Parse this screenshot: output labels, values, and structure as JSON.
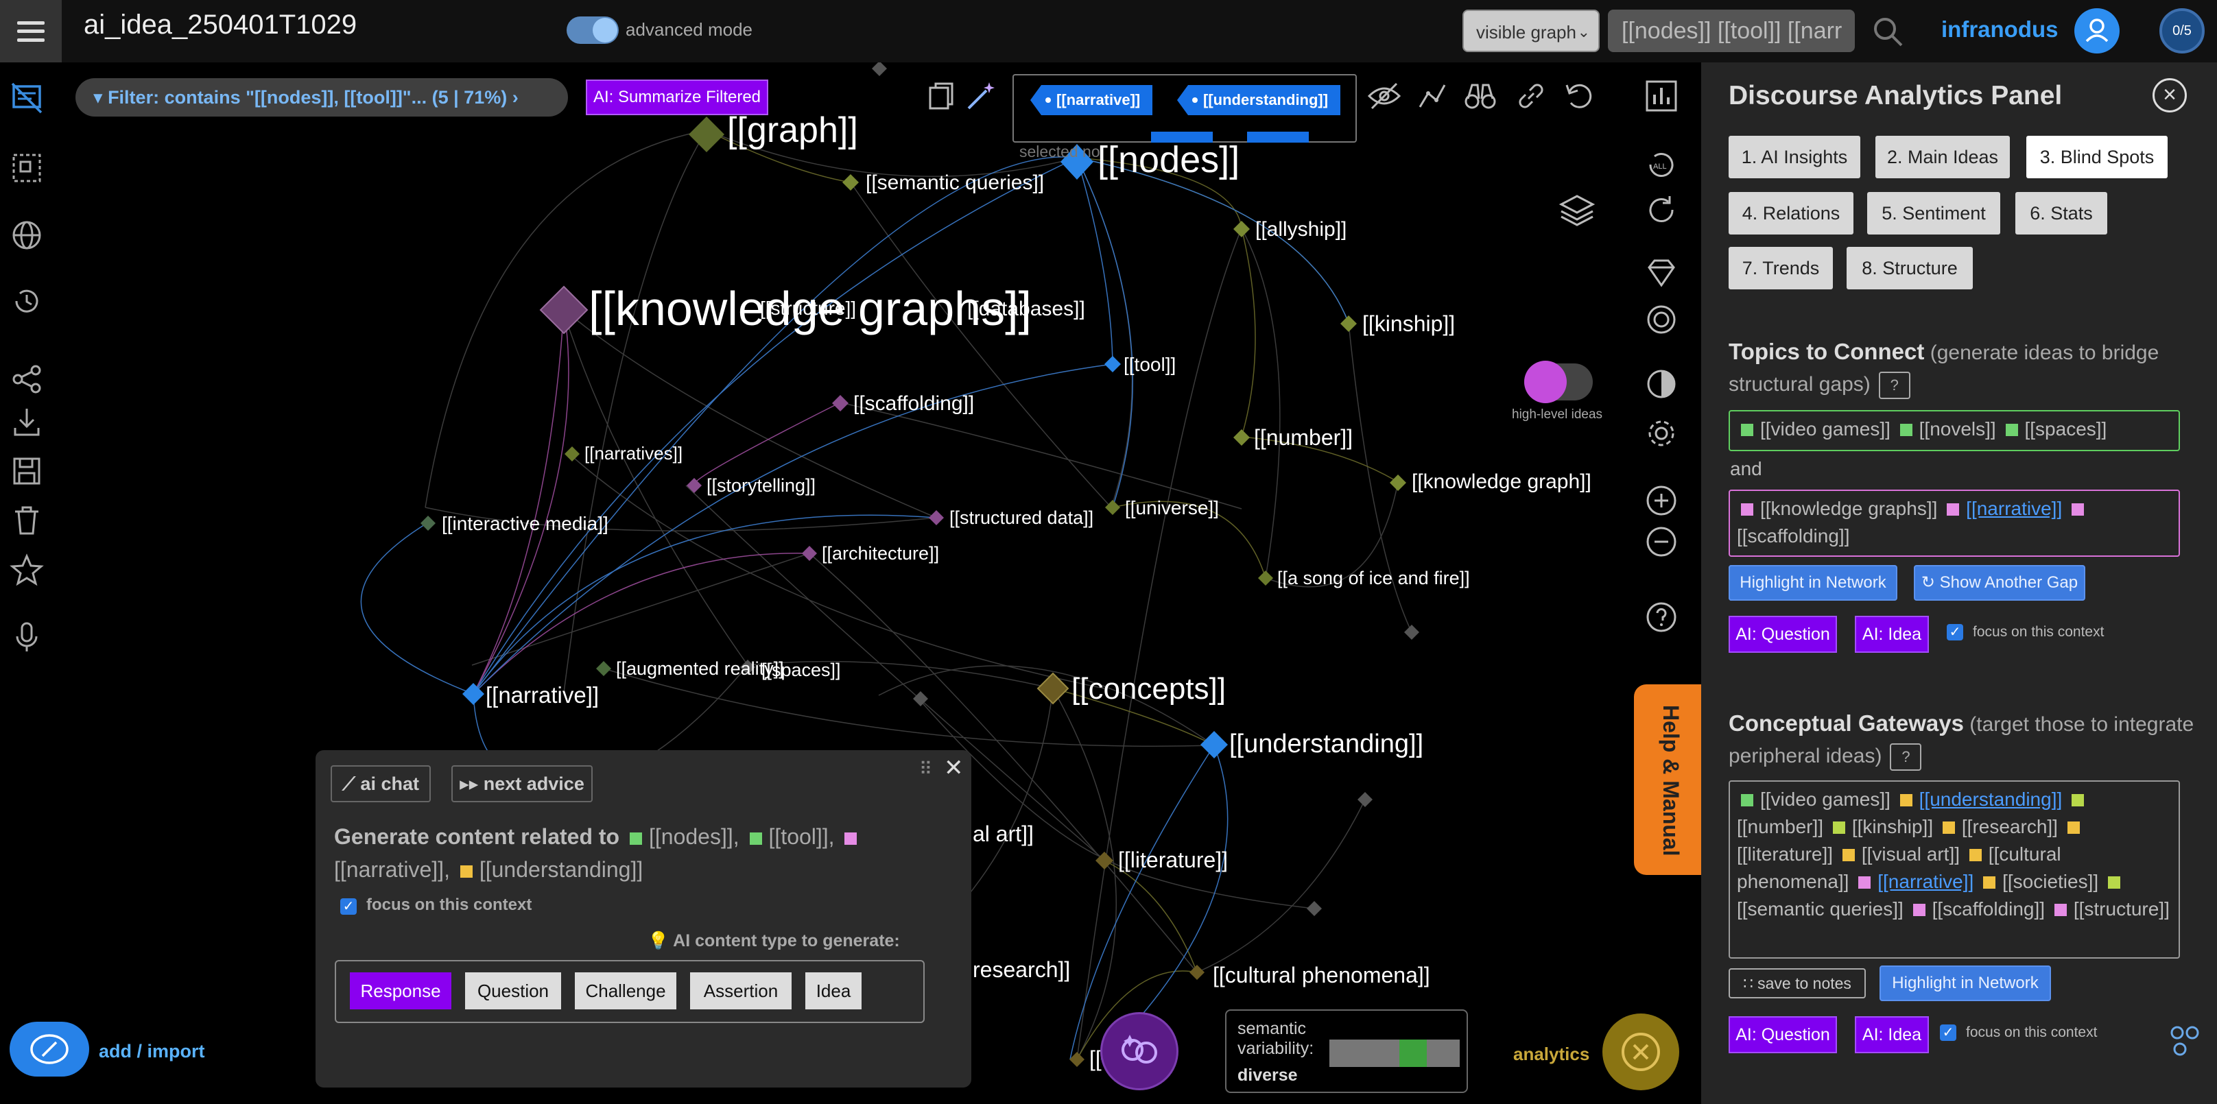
{
  "header": {
    "title": "ai_idea_250401T1029",
    "advanced_mode_label": "advanced mode",
    "graph_select_value": "visible graph",
    "search_value": "[[nodes]] [[tool]] [[narr",
    "brand": "infranodus",
    "counter": "0/5"
  },
  "left_rail": {
    "add_import_label": "add / import"
  },
  "filter": {
    "label": "Filter: contains \"[[nodes]], [[tool]]\"... (5 | 71%)",
    "summarize_button": "AI: Summarize Filtered",
    "tags": [
      "[[narrative]]",
      "[[understanding]]"
    ],
    "selected_label": "selected no"
  },
  "graph": {
    "labels": [
      {
        "text": "[[graph]]",
        "size": 52
      },
      {
        "text": "[[semantic queries]]",
        "size": 30
      },
      {
        "text": "[[nodes]]",
        "size": 54
      },
      {
        "text": "[[allyship]]",
        "size": 30
      },
      {
        "text": "[[knowledge graphs]]",
        "size": 70
      },
      {
        "text": "[[structure]]",
        "size": 28
      },
      {
        "text": "[[databases]]",
        "size": 30
      },
      {
        "text": "[[kinship]]",
        "size": 32
      },
      {
        "text": "[[tool]]",
        "size": 28
      },
      {
        "text": "[[scaffolding]]",
        "size": 30
      },
      {
        "text": "[[number]]",
        "size": 32
      },
      {
        "text": "[[narratives]]",
        "size": 26
      },
      {
        "text": "[[knowledge graph]]",
        "size": 30
      },
      {
        "text": "[[storytelling]]",
        "size": 27
      },
      {
        "text": "[[interactive media]]",
        "size": 28
      },
      {
        "text": "[[structured data]]",
        "size": 27
      },
      {
        "text": "[[universe]]",
        "size": 28
      },
      {
        "text": "[[architecture]]",
        "size": 27
      },
      {
        "text": "[[a song of ice and fire]]",
        "size": 27
      },
      {
        "text": "[[augmented reality]]",
        "size": 27
      },
      {
        "text": "[[spaces]]",
        "size": 27
      },
      {
        "text": "[[narrative]]",
        "size": 33
      },
      {
        "text": "[[concepts]]",
        "size": 44
      },
      {
        "text": "[[understanding]]",
        "size": 38
      },
      {
        "text": "al art]]",
        "size": 32
      },
      {
        "text": "[[literature]]",
        "size": 32
      },
      {
        "text": "research]]",
        "size": 32
      },
      {
        "text": "[[cultural phenomena]]",
        "size": 32
      },
      {
        "text": "[[",
        "size": 32
      }
    ],
    "high_level_ideas_label": "high-level ideas"
  },
  "chat": {
    "ai_chat_tab": "ai chat",
    "next_advice_tab": "next advice",
    "generate_prefix": "Generate content related to",
    "generate_items": [
      "[[nodes]],",
      "[[tool]],",
      "[[narrative]],",
      "[[understanding]]"
    ],
    "focus_label": "focus on this context",
    "content_type_label": "AI content type to generate:",
    "types": [
      "Response",
      "Question",
      "Challenge",
      "Assertion",
      "Idea"
    ]
  },
  "variability": {
    "label": "semantic variability:",
    "value": "diverse"
  },
  "analytics_label": "analytics",
  "help_tab": "Help & Manual",
  "panel": {
    "title": "Discourse Analytics Panel",
    "tabs": [
      "1. AI Insights",
      "2. Main Ideas",
      "3. Blind Spots",
      "4. Relations",
      "5. Sentiment",
      "6. Stats",
      "7. Trends",
      "8. Structure"
    ],
    "topics": {
      "heading": "Topics to Connect",
      "subheading": "(generate ideas to bridge structural gaps)",
      "qmark": "?",
      "group1": [
        "[[video games]]",
        "[[novels]]",
        "[[spaces]]"
      ],
      "and_label": "and",
      "group2": [
        "[[knowledge graphs]]",
        "[[narrative]]",
        "[[scaffolding]]"
      ],
      "highlight_button": "Highlight in Network",
      "another_gap_button": "↻ Show Another Gap",
      "ai_question": "AI: Question",
      "ai_idea": "AI: Idea",
      "focus_label": "focus on this context"
    },
    "gateways": {
      "heading": "Conceptual Gateways",
      "subheading": "(target those to integrate peripheral ideas)",
      "qmark": "?",
      "items": [
        "[[video games]]",
        "[[understanding]]",
        "[[number]]",
        "[[kinship]]",
        "[[research]]",
        "[[literature]]",
        "[[visual art]]",
        "[[cultural phenomena]]",
        "[[narrative]]",
        "[[societies]]",
        "[[semantic queries]]",
        "[[scaffolding]]",
        "[[structure]]"
      ],
      "save_button": "save to notes",
      "highlight_button": "Highlight in Network",
      "ai_question": "AI: Question",
      "ai_idea": "AI: Idea",
      "focus_label": "focus on this context"
    }
  },
  "colors": {
    "accent_blue": "#3a9ef7",
    "purple": "#8a00f0",
    "green_cluster": "#6fd26f",
    "pink_cluster": "#e58ce5",
    "yellow_cluster": "#f0c040",
    "orange_help": "#ef7d1d"
  }
}
